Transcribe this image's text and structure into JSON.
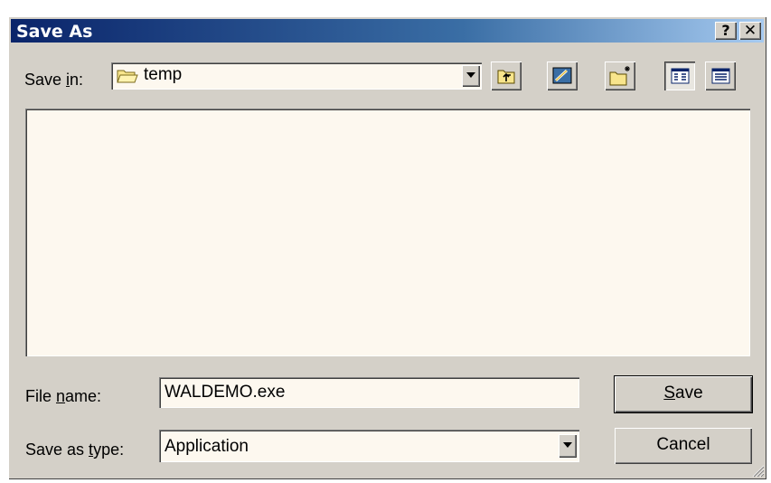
{
  "window": {
    "title": "Save As",
    "help_label": "?",
    "close_label": "✕"
  },
  "toolbar": {
    "save_in_label_pre": "Save ",
    "save_in_label_key": "i",
    "save_in_label_post": "n:",
    "folder_name": "temp",
    "folder_icon": "folder-icon",
    "buttons": [
      "up-one-level-icon",
      "desktop-icon",
      "new-folder-icon",
      "list-view-icon",
      "details-view-icon"
    ]
  },
  "form": {
    "file_name_label_pre": "File ",
    "file_name_label_key": "n",
    "file_name_label_post": "ame:",
    "file_name_value": "WALDEMO.exe",
    "save_type_label_pre": "Save as ",
    "save_type_label_key": "t",
    "save_type_label_post": "ype:",
    "save_type_value": "Application"
  },
  "buttons": {
    "save_key": "S",
    "save_rest": "ave",
    "cancel": "Cancel"
  }
}
